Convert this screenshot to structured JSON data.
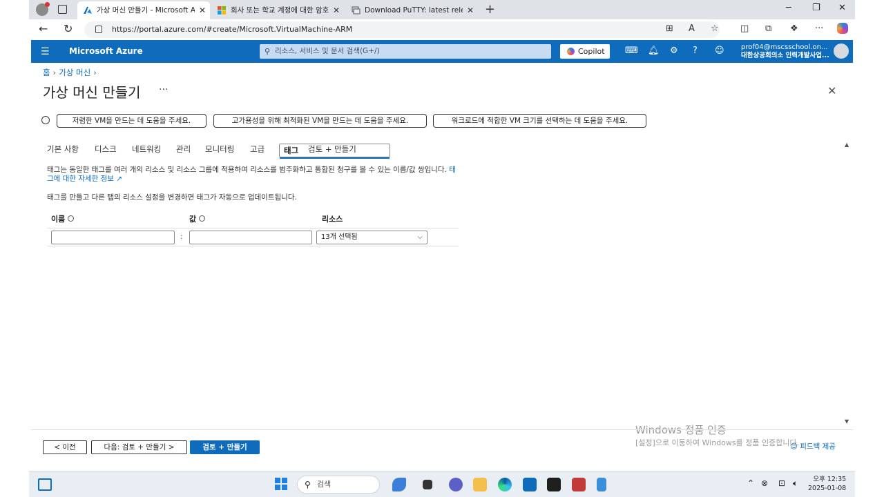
{
  "browser": {
    "tabs": [
      {
        "title": "가상 머신 만들기 - Microsoft Azure",
        "active": true
      },
      {
        "title": "회사 또는 학교 계정에 대한 암호",
        "active": false
      },
      {
        "title": "Download PuTTY: latest release (0.",
        "active": false
      }
    ],
    "url": "https://portal.azure.com/#create/Microsoft.VirtualMachine-ARM"
  },
  "azure": {
    "brand": "Microsoft Azure",
    "search_placeholder": "리소스, 서비스 및 문서 검색(G+/)",
    "copilot_label": "Copilot",
    "account_email": "prof04@mscsschool.on...",
    "account_org": "대한상공회의소 인력개발사업..."
  },
  "breadcrumb": [
    "홈",
    "가상 머신"
  ],
  "page_title": "가상 머신 만들기",
  "help_buttons": [
    "저렴한 VM을 만드는 데 도움을 주세요.",
    "고가용성을 위해 최적화된 VM을 만드는 데 도움을 주세요.",
    "워크로드에 적합한 VM 크기를 선택하는 데 도움을 주세요."
  ],
  "tabs": [
    "기본 사항",
    "디스크",
    "네트워킹",
    "관리",
    "모니터링",
    "고급",
    "태그",
    "검토 + 만들기"
  ],
  "selected_tab": "태그",
  "description": {
    "text": "태그는 동일한 태그를 여러 개의 리소스 및 리소스 그룹에 적용하여 리소스를 범주화하고 통합된 청구를 볼 수 있는 이름/값 쌍입니다.",
    "link": "태그에 대한 자세한 정보",
    "note": "태그를 만들고 다른 탭의 리소스 설정을 변경하면 태그가 자동으로 업데이트됩니다."
  },
  "table": {
    "headers": {
      "name": "이름",
      "value": "값",
      "resource": "리소스"
    },
    "row": {
      "name": "",
      "value": "",
      "resource": "13개 선택됨"
    }
  },
  "footer": {
    "prev": "< 이전",
    "next": "다음: 검토 + 만들기 >",
    "create": "검토 + 만들기",
    "feedback": "피드백 제공"
  },
  "watermark": {
    "line1": "Windows 정품 인증",
    "line2": "[설정]으로 이동하여 Windows를 정품 인증합니다."
  },
  "taskbar": {
    "search_placeholder": "검색",
    "time": "오후 12:35",
    "date": "2025-01-08"
  }
}
